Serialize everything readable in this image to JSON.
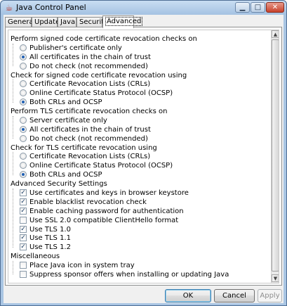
{
  "window": {
    "title": "Java Control Panel",
    "icon": "java-cup-icon",
    "controls": {
      "minimize": "minimize-icon",
      "maximize": "maximize-icon",
      "close": "close-icon"
    }
  },
  "tabs": [
    {
      "label": "General",
      "active": false
    },
    {
      "label": "Update",
      "active": false
    },
    {
      "label": "Java",
      "active": false
    },
    {
      "label": "Security",
      "active": false
    },
    {
      "label": "Advanced",
      "active": true
    }
  ],
  "settings": {
    "items": [
      {
        "kind": "section",
        "label": "Perform signed code certificate revocation checks on"
      },
      {
        "kind": "radio",
        "label": "Publisher's certificate only",
        "checked": false
      },
      {
        "kind": "radio",
        "label": "All certificates in the chain of trust",
        "checked": true
      },
      {
        "kind": "radio",
        "label": "Do not check (not recommended)",
        "checked": false
      },
      {
        "kind": "section",
        "label": "Check for signed code certificate revocation using"
      },
      {
        "kind": "radio",
        "label": "Certificate Revocation Lists (CRLs)",
        "checked": false
      },
      {
        "kind": "radio",
        "label": "Online Certificate Status Protocol (OCSP)",
        "checked": false
      },
      {
        "kind": "radio",
        "label": "Both CRLs and OCSP",
        "checked": true
      },
      {
        "kind": "section",
        "label": "Perform TLS certificate revocation checks on"
      },
      {
        "kind": "radio",
        "label": "Server certificate only",
        "checked": false
      },
      {
        "kind": "radio",
        "label": "All certificates in the chain of trust",
        "checked": true
      },
      {
        "kind": "radio",
        "label": "Do not check (not recommended)",
        "checked": false
      },
      {
        "kind": "section",
        "label": "Check for TLS certificate revocation using"
      },
      {
        "kind": "radio",
        "label": "Certificate Revocation Lists (CRLs)",
        "checked": false
      },
      {
        "kind": "radio",
        "label": "Online Certificate Status Protocol (OCSP)",
        "checked": false
      },
      {
        "kind": "radio",
        "label": "Both CRLs and OCSP",
        "checked": true
      },
      {
        "kind": "section",
        "label": "Advanced Security Settings"
      },
      {
        "kind": "checkbox",
        "label": "Use certificates and keys in browser keystore",
        "checked": true
      },
      {
        "kind": "checkbox",
        "label": "Enable blacklist revocation check",
        "checked": true
      },
      {
        "kind": "checkbox",
        "label": "Enable caching password for authentication",
        "checked": true
      },
      {
        "kind": "checkbox",
        "label": "Use SSL 2.0 compatible ClientHello format",
        "checked": false
      },
      {
        "kind": "checkbox",
        "label": "Use TLS 1.0",
        "checked": true
      },
      {
        "kind": "checkbox",
        "label": "Use TLS 1.1",
        "checked": true
      },
      {
        "kind": "checkbox",
        "label": "Use TLS 1.2",
        "checked": true
      },
      {
        "kind": "section",
        "label": "Miscellaneous"
      },
      {
        "kind": "checkbox",
        "label": "Place Java icon in system tray",
        "checked": false
      },
      {
        "kind": "checkbox",
        "label": "Suppress sponsor offers when installing or updating Java",
        "checked": false,
        "highlighted": true
      }
    ]
  },
  "buttons": {
    "ok": "OK",
    "cancel": "Cancel",
    "apply": "Apply"
  },
  "colors": {
    "highlight": "#d0211f",
    "window_frame": "#a9c5e3",
    "dialog_bg": "#f0f0f0"
  }
}
